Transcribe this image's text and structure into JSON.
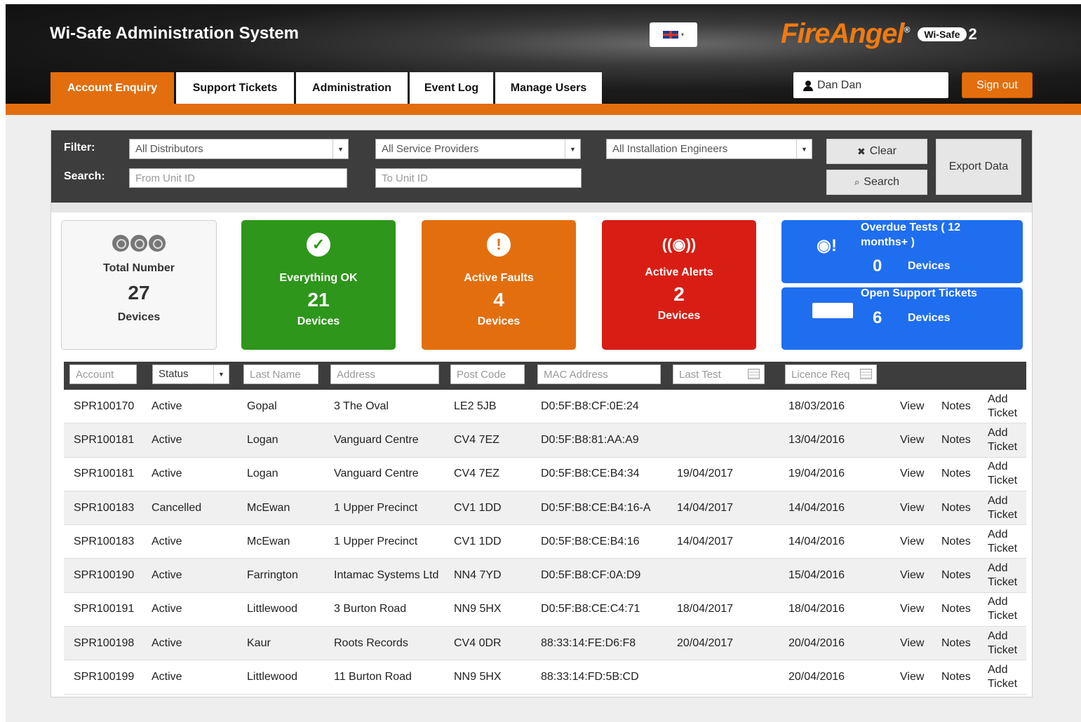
{
  "app": {
    "title": "Wi-Safe Administration System",
    "brand": "FireAngel",
    "brand_registered": "®",
    "brand_product": "Wi-Safe",
    "brand_version": "2"
  },
  "tabs": [
    {
      "label": "Account Enquiry",
      "active": true
    },
    {
      "label": "Support Tickets",
      "active": false
    },
    {
      "label": "Administration",
      "active": false
    },
    {
      "label": "Event Log",
      "active": false
    },
    {
      "label": "Manage Users",
      "active": false
    }
  ],
  "user": {
    "name": "Dan Dan",
    "signout_label": "Sign out"
  },
  "language": {
    "icon": "uk-flag-icon",
    "caret": "▾"
  },
  "filter": {
    "filter_label": "Filter:",
    "search_label": "Search:",
    "distributors": "All Distributors",
    "service_providers": "All Service Providers",
    "engineers": "All Installation Engineers",
    "from_unit_placeholder": "From Unit ID",
    "to_unit_placeholder": "To Unit ID",
    "clear_label": "Clear",
    "search_button_label": "Search",
    "export_label": "Export Data"
  },
  "cards": {
    "total": {
      "title": "Total Number",
      "value": "27",
      "unit": "Devices"
    },
    "ok": {
      "title": "Everything OK",
      "value": "21",
      "unit": "Devices",
      "icon": "✓"
    },
    "faults": {
      "title": "Active Faults",
      "value": "4",
      "unit": "Devices",
      "icon": "!"
    },
    "alerts": {
      "title": "Active Alerts",
      "value": "2",
      "unit": "Devices",
      "icon": "((◉))"
    },
    "overdue": {
      "title": "Overdue Tests ( 12 months+ )",
      "value": "0",
      "unit": "Devices"
    },
    "tickets": {
      "title": "Open Support Tickets",
      "value": "6",
      "unit": "Devices"
    }
  },
  "colors": {
    "accent": "#e36e0e",
    "ok": "#2e961b",
    "alert": "#d81e14",
    "info": "#1f6ef0"
  },
  "table": {
    "filters": {
      "account": "Account",
      "status": "Status",
      "last_name": "Last Name",
      "address": "Address",
      "post_code": "Post Code",
      "mac": "MAC Address",
      "last_test": "Last Test",
      "licence": "Licence Req"
    },
    "row_actions": {
      "view": "View",
      "notes": "Notes",
      "add": "Add",
      "ticket": "Ticket"
    },
    "rows": [
      {
        "account": "SPR100170",
        "status": "Active",
        "last_name": "Gopal",
        "address": "3 The Oval",
        "post_code": "LE2 5JB",
        "mac": "D0:5F:B8:CF:0E:24",
        "last_test": "",
        "licence": "18/03/2016"
      },
      {
        "account": "SPR100181",
        "status": "Active",
        "last_name": "Logan",
        "address": "Vanguard Centre",
        "post_code": "CV4 7EZ",
        "mac": "D0:5F:B8:81:AA:A9",
        "last_test": "",
        "licence": "13/04/2016"
      },
      {
        "account": "SPR100181",
        "status": "Active",
        "last_name": "Logan",
        "address": "Vanguard Centre",
        "post_code": "CV4 7EZ",
        "mac": "D0:5F:B8:CE:B4:34",
        "last_test": "19/04/2017",
        "licence": "19/04/2016"
      },
      {
        "account": "SPR100183",
        "status": "Cancelled",
        "last_name": "McEwan",
        "address": "1 Upper Precinct",
        "post_code": "CV1 1DD",
        "mac": "D0:5F:B8:CE:B4:16-A",
        "last_test": "14/04/2017",
        "licence": "14/04/2016"
      },
      {
        "account": "SPR100183",
        "status": "Active",
        "last_name": "McEwan",
        "address": "1 Upper Precinct",
        "post_code": "CV1 1DD",
        "mac": "D0:5F:B8:CE:B4:16",
        "last_test": "14/04/2017",
        "licence": "14/04/2016"
      },
      {
        "account": "SPR100190",
        "status": "Active",
        "last_name": "Farrington",
        "address": "Intamac Systems Ltd",
        "post_code": "NN4 7YD",
        "mac": "D0:5F:B8:CF:0A:D9",
        "last_test": "",
        "licence": "15/04/2016"
      },
      {
        "account": "SPR100191",
        "status": "Active",
        "last_name": "Littlewood",
        "address": "3 Burton Road",
        "post_code": "NN9 5HX",
        "mac": "D0:5F:B8:CE:C4:71",
        "last_test": "18/04/2017",
        "licence": "18/04/2016"
      },
      {
        "account": "SPR100198",
        "status": "Active",
        "last_name": "Kaur",
        "address": "Roots Records",
        "post_code": "CV4 0DR",
        "mac": "88:33:14:FE:D6:F8",
        "last_test": "20/04/2017",
        "licence": "20/04/2016"
      },
      {
        "account": "SPR100199",
        "status": "Active",
        "last_name": "Littlewood",
        "address": "11 Burton Road",
        "post_code": "NN9 5HX",
        "mac": "88:33:14:FD:5B:CD",
        "last_test": "",
        "licence": "20/04/2016"
      }
    ]
  }
}
